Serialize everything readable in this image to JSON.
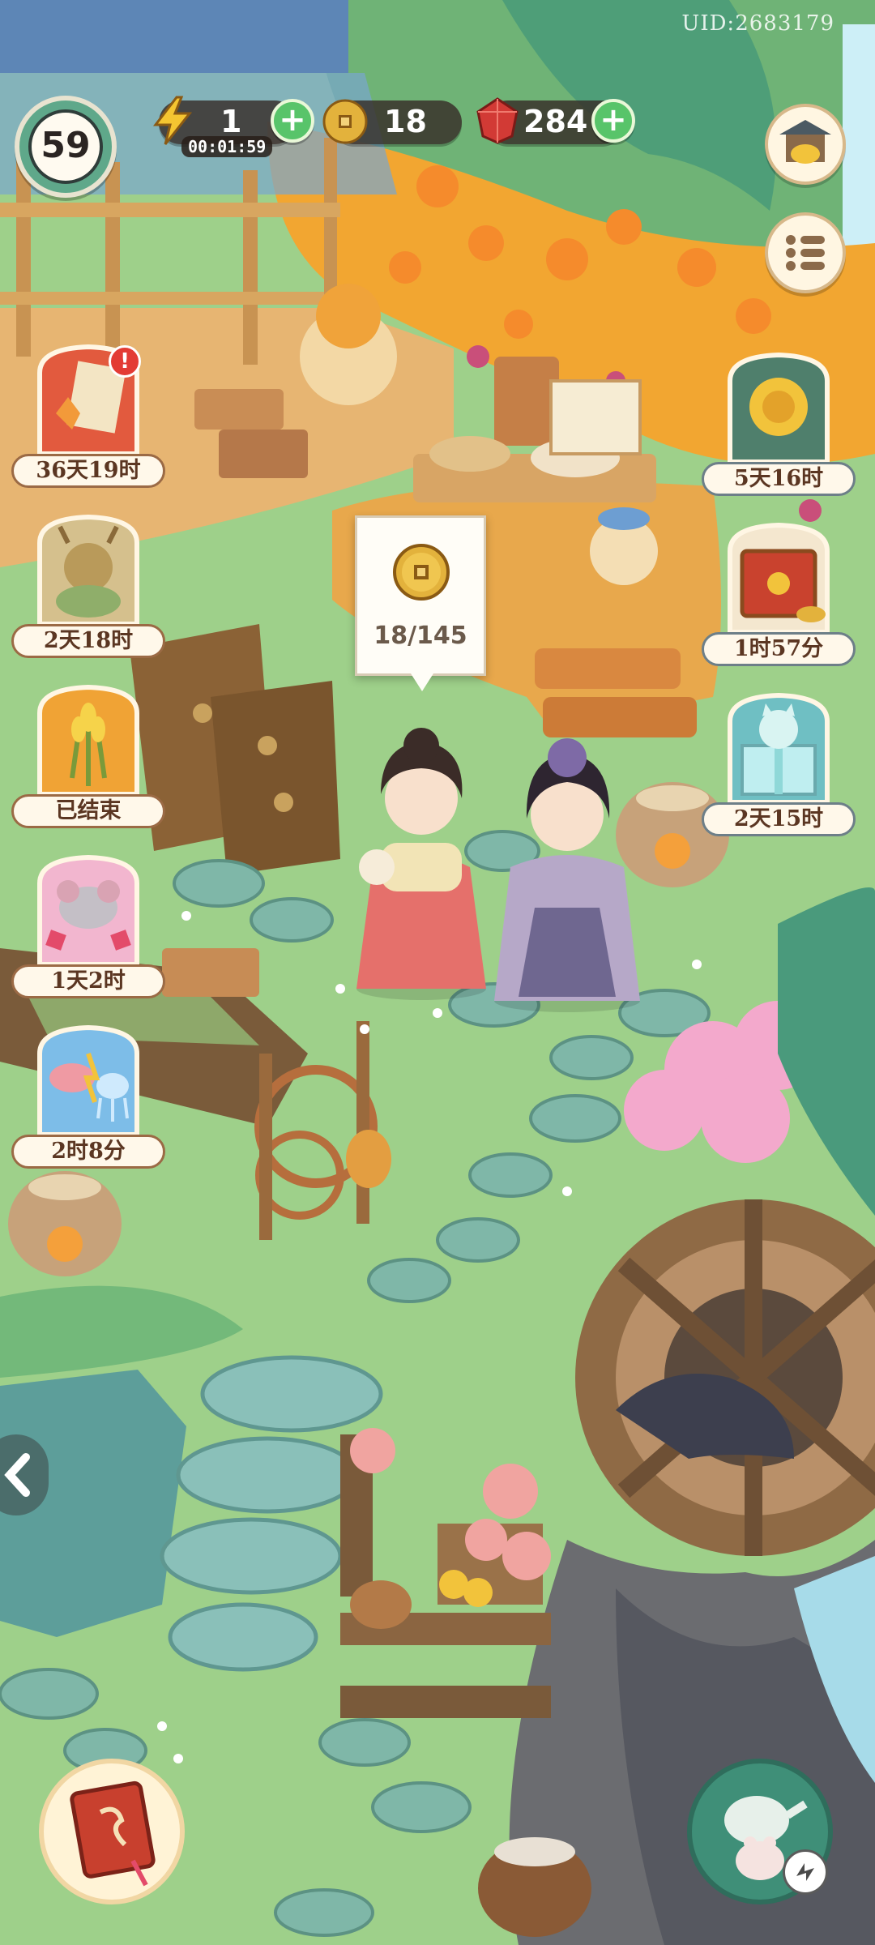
{
  "uid": "UID:2683179",
  "player": {
    "level": "59"
  },
  "resources": {
    "energy": {
      "icon": "lightning-icon",
      "value": "1",
      "timer": "00:01:59"
    },
    "coins": {
      "icon": "coin-icon",
      "value": "18"
    },
    "gems": {
      "icon": "ruby-icon",
      "value": "284"
    }
  },
  "left_events": [
    {
      "name": "event-maple-letter",
      "icon": "maple-letter-icon",
      "label": "36天19时",
      "badge": "!"
    },
    {
      "name": "event-deer-spirit",
      "icon": "deer-spirit-icon",
      "label": "2天18时"
    },
    {
      "name": "event-wheat",
      "icon": "wheat-icon",
      "label": "已结束"
    },
    {
      "name": "event-mouse-blossom",
      "icon": "mouse-blossom-icon",
      "label": "1天2时"
    },
    {
      "name": "event-fish-jellyfish",
      "icon": "fish-jellyfish-icon",
      "label": "2时8分"
    }
  ],
  "right_events": [
    {
      "name": "event-chrysanthemum",
      "icon": "chrysanthemum-icon",
      "label": "5天16时"
    },
    {
      "name": "event-treasure-box",
      "icon": "treasure-box-icon",
      "label": "1时57分"
    },
    {
      "name": "event-cat-gift",
      "icon": "cat-gift-icon",
      "label": "2天15时"
    }
  ],
  "tooltip": {
    "icon": "coin-icon",
    "text": "18/145"
  },
  "colors": {
    "grass": "#9ed08a",
    "wood": "#b88654",
    "roof": "#5d86b6",
    "coin": "#e3b23c",
    "gem": "#d23a35",
    "plus": "#58c46a"
  }
}
